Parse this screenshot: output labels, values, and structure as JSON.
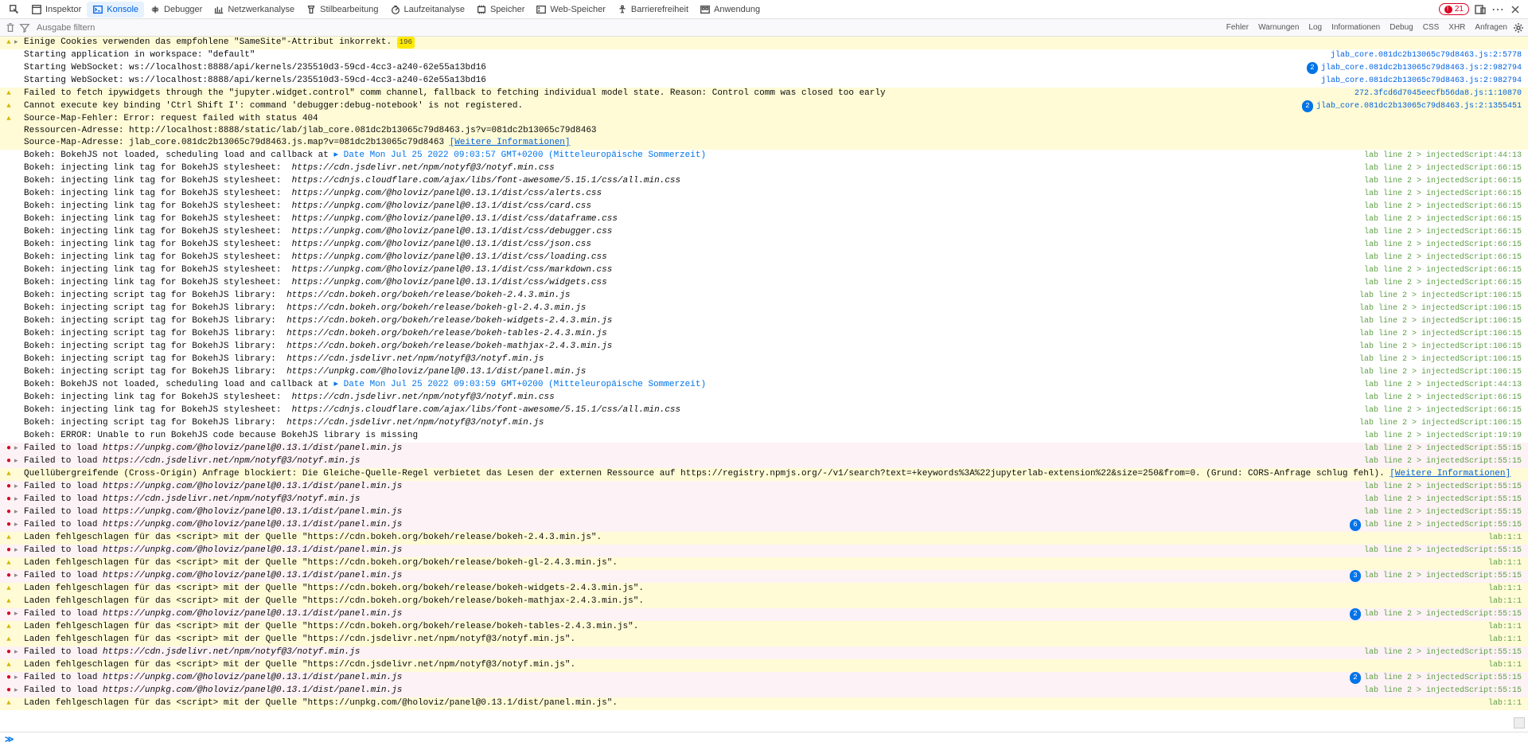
{
  "toolbar": {
    "tabs": [
      {
        "id": "pick",
        "label": "",
        "icon": "pick"
      },
      {
        "id": "inspector",
        "label": "Inspektor",
        "icon": "inspector"
      },
      {
        "id": "konsole",
        "label": "Konsole",
        "icon": "console",
        "active": true
      },
      {
        "id": "debugger",
        "label": "Debugger",
        "icon": "debugger"
      },
      {
        "id": "netz",
        "label": "Netzwerkanalyse",
        "icon": "network"
      },
      {
        "id": "stil",
        "label": "Stilbearbeitung",
        "icon": "style"
      },
      {
        "id": "lauf",
        "label": "Laufzeitanalyse",
        "icon": "perf"
      },
      {
        "id": "speicher",
        "label": "Speicher",
        "icon": "memory"
      },
      {
        "id": "web",
        "label": "Web-Speicher",
        "icon": "storage"
      },
      {
        "id": "barrier",
        "label": "Barrierefreiheit",
        "icon": "a11y"
      },
      {
        "id": "anwend",
        "label": "Anwendung",
        "icon": "app"
      }
    ],
    "error_count": "21"
  },
  "filterbar": {
    "placeholder": "Ausgabe filtern",
    "buttons": [
      "Fehler",
      "Warnungen",
      "Log",
      "Informationen",
      "Debug",
      "CSS",
      "XHR",
      "Anfragen"
    ]
  },
  "messages": [
    {
      "t": "warn",
      "exp": true,
      "badge": "196",
      "text": "Einige Cookies verwenden das empfohlene \"SameSite\"-Attribut inkorrekt.",
      "loc": ""
    },
    {
      "t": "info",
      "text": "Starting application in workspace: \"default\"",
      "loc": "jlab_core.081dc2b13065c79d8463.js:2:5778",
      "locfile": true
    },
    {
      "t": "info",
      "badge": "2",
      "text": "Starting WebSocket: ws://localhost:8888/api/kernels/235510d3-59cd-4cc3-a240-62e55a13bd16",
      "loc": "jlab_core.081dc2b13065c79d8463.js:2:982794",
      "locfile": true
    },
    {
      "t": "info",
      "text": "Starting WebSocket: ws://localhost:8888/api/kernels/235510d3-59cd-4cc3-a240-62e55a13bd16",
      "loc": "jlab_core.081dc2b13065c79d8463.js:2:982794",
      "locfile": true
    },
    {
      "t": "warn",
      "text": "Failed to fetch ipywidgets through the \"jupyter.widget.control\" comm channel, fallback to fetching individual model state. Reason: Control comm was closed too early",
      "loc": "272.3fcd6d7045eecfb56da8.js:1:10870",
      "locfile": true
    },
    {
      "t": "warn",
      "badge": "2",
      "text": "Cannot execute key binding 'Ctrl Shift I': command 'debugger:debug-notebook' is not registered.",
      "loc": "jlab_core.081dc2b13065c79d8463.js:2:1355451",
      "locfile": true
    },
    {
      "t": "warn",
      "multiline": true,
      "text": "Source-Map-Fehler: Error: request failed with status 404\nRessourcen-Adresse: http://localhost:8888/static/lab/jlab_core.081dc2b13065c79d8463.js?v=081dc2b13065c79d8463\nSource-Map-Adresse: jlab_core.081dc2b13065c79d8463.js.map?v=081dc2b13065c79d8463 ",
      "link": "[Weitere Informationen]",
      "loc": ""
    },
    {
      "t": "info",
      "text": "Bokeh: BokehJS not loaded, scheduling load and callback at ",
      "date": "▸ Date Mon Jul 25 2022 09:03:57 GMT+0200 (Mitteleuropäische Sommerzeit)",
      "loc": "lab line 2 > injectedScript:44:13"
    },
    {
      "t": "info",
      "text": "Bokeh: injecting link tag for BokehJS stylesheet:  ",
      "url": "https://cdn.jsdelivr.net/npm/notyf@3/notyf.min.css",
      "loc": "lab line 2 > injectedScript:66:15"
    },
    {
      "t": "info",
      "text": "Bokeh: injecting link tag for BokehJS stylesheet:  ",
      "url": "https://cdnjs.cloudflare.com/ajax/libs/font-awesome/5.15.1/css/all.min.css",
      "loc": "lab line 2 > injectedScript:66:15"
    },
    {
      "t": "info",
      "text": "Bokeh: injecting link tag for BokehJS stylesheet:  ",
      "url": "https://unpkg.com/@holoviz/panel@0.13.1/dist/css/alerts.css",
      "loc": "lab line 2 > injectedScript:66:15"
    },
    {
      "t": "info",
      "text": "Bokeh: injecting link tag for BokehJS stylesheet:  ",
      "url": "https://unpkg.com/@holoviz/panel@0.13.1/dist/css/card.css",
      "loc": "lab line 2 > injectedScript:66:15"
    },
    {
      "t": "info",
      "text": "Bokeh: injecting link tag for BokehJS stylesheet:  ",
      "url": "https://unpkg.com/@holoviz/panel@0.13.1/dist/css/dataframe.css",
      "loc": "lab line 2 > injectedScript:66:15"
    },
    {
      "t": "info",
      "text": "Bokeh: injecting link tag for BokehJS stylesheet:  ",
      "url": "https://unpkg.com/@holoviz/panel@0.13.1/dist/css/debugger.css",
      "loc": "lab line 2 > injectedScript:66:15"
    },
    {
      "t": "info",
      "text": "Bokeh: injecting link tag for BokehJS stylesheet:  ",
      "url": "https://unpkg.com/@holoviz/panel@0.13.1/dist/css/json.css",
      "loc": "lab line 2 > injectedScript:66:15"
    },
    {
      "t": "info",
      "text": "Bokeh: injecting link tag for BokehJS stylesheet:  ",
      "url": "https://unpkg.com/@holoviz/panel@0.13.1/dist/css/loading.css",
      "loc": "lab line 2 > injectedScript:66:15"
    },
    {
      "t": "info",
      "text": "Bokeh: injecting link tag for BokehJS stylesheet:  ",
      "url": "https://unpkg.com/@holoviz/panel@0.13.1/dist/css/markdown.css",
      "loc": "lab line 2 > injectedScript:66:15"
    },
    {
      "t": "info",
      "text": "Bokeh: injecting link tag for BokehJS stylesheet:  ",
      "url": "https://unpkg.com/@holoviz/panel@0.13.1/dist/css/widgets.css",
      "loc": "lab line 2 > injectedScript:66:15"
    },
    {
      "t": "info",
      "text": "Bokeh: injecting script tag for BokehJS library:  ",
      "url": "https://cdn.bokeh.org/bokeh/release/bokeh-2.4.3.min.js",
      "loc": "lab line 2 > injectedScript:106:15"
    },
    {
      "t": "info",
      "text": "Bokeh: injecting script tag for BokehJS library:  ",
      "url": "https://cdn.bokeh.org/bokeh/release/bokeh-gl-2.4.3.min.js",
      "loc": "lab line 2 > injectedScript:106:15"
    },
    {
      "t": "info",
      "text": "Bokeh: injecting script tag for BokehJS library:  ",
      "url": "https://cdn.bokeh.org/bokeh/release/bokeh-widgets-2.4.3.min.js",
      "loc": "lab line 2 > injectedScript:106:15"
    },
    {
      "t": "info",
      "text": "Bokeh: injecting script tag for BokehJS library:  ",
      "url": "https://cdn.bokeh.org/bokeh/release/bokeh-tables-2.4.3.min.js",
      "loc": "lab line 2 > injectedScript:106:15"
    },
    {
      "t": "info",
      "text": "Bokeh: injecting script tag for BokehJS library:  ",
      "url": "https://cdn.bokeh.org/bokeh/release/bokeh-mathjax-2.4.3.min.js",
      "loc": "lab line 2 > injectedScript:106:15"
    },
    {
      "t": "info",
      "text": "Bokeh: injecting script tag for BokehJS library:  ",
      "url": "https://cdn.jsdelivr.net/npm/notyf@3/notyf.min.js",
      "loc": "lab line 2 > injectedScript:106:15"
    },
    {
      "t": "info",
      "text": "Bokeh: injecting script tag for BokehJS library:  ",
      "url": "https://unpkg.com/@holoviz/panel@0.13.1/dist/panel.min.js",
      "loc": "lab line 2 > injectedScript:106:15"
    },
    {
      "t": "info",
      "text": "Bokeh: BokehJS not loaded, scheduling load and callback at ",
      "date": "▸ Date Mon Jul 25 2022 09:03:59 GMT+0200 (Mitteleuropäische Sommerzeit)",
      "loc": "lab line 2 > injectedScript:44:13"
    },
    {
      "t": "info",
      "text": "Bokeh: injecting link tag for BokehJS stylesheet:  ",
      "url": "https://cdn.jsdelivr.net/npm/notyf@3/notyf.min.css",
      "loc": "lab line 2 > injectedScript:66:15"
    },
    {
      "t": "info",
      "text": "Bokeh: injecting link tag for BokehJS stylesheet:  ",
      "url": "https://cdnjs.cloudflare.com/ajax/libs/font-awesome/5.15.1/css/all.min.css",
      "loc": "lab line 2 > injectedScript:66:15"
    },
    {
      "t": "info",
      "text": "Bokeh: injecting script tag for BokehJS library:  ",
      "url": "https://cdn.jsdelivr.net/npm/notyf@3/notyf.min.js",
      "loc": "lab line 2 > injectedScript:106:15"
    },
    {
      "t": "info",
      "text": "Bokeh: ERROR: Unable to run BokehJS code because BokehJS library is missing",
      "loc": "lab line 2 > injectedScript:19:19"
    },
    {
      "t": "err",
      "exp": true,
      "text": "Failed to load ",
      "url": "https://unpkg.com/@holoviz/panel@0.13.1/dist/panel.min.js",
      "loc": "lab line 2 > injectedScript:55:15"
    },
    {
      "t": "err",
      "exp": true,
      "text": "Failed to load ",
      "url": "https://cdn.jsdelivr.net/npm/notyf@3/notyf.min.js",
      "loc": "lab line 2 > injectedScript:55:15"
    },
    {
      "t": "warn",
      "text": "Quellübergreifende (Cross-Origin) Anfrage blockiert: Die Gleiche-Quelle-Regel verbietet das Lesen der externen Ressource auf https://registry.npmjs.org/-/v1/search?text=+keywords%3A%22jupyterlab-extension%22&size=250&from=0. (Grund: CORS-Anfrage schlug fehl). ",
      "link": "[Weitere Informationen]",
      "loc": ""
    },
    {
      "t": "err",
      "exp": true,
      "text": "Failed to load ",
      "url": "https://unpkg.com/@holoviz/panel@0.13.1/dist/panel.min.js",
      "loc": "lab line 2 > injectedScript:55:15"
    },
    {
      "t": "err",
      "exp": true,
      "text": "Failed to load ",
      "url": "https://cdn.jsdelivr.net/npm/notyf@3/notyf.min.js",
      "loc": "lab line 2 > injectedScript:55:15"
    },
    {
      "t": "err",
      "exp": true,
      "text": "Failed to load ",
      "url": "https://unpkg.com/@holoviz/panel@0.13.1/dist/panel.min.js",
      "loc": "lab line 2 > injectedScript:55:15"
    },
    {
      "t": "err",
      "exp": true,
      "badge": "6",
      "text": "Failed to load ",
      "url": "https://unpkg.com/@holoviz/panel@0.13.1/dist/panel.min.js",
      "loc": "lab line 2 > injectedScript:55:15"
    },
    {
      "t": "warn",
      "text": "Laden fehlgeschlagen für das <script> mit der Quelle \"https://cdn.bokeh.org/bokeh/release/bokeh-2.4.3.min.js\".",
      "loc": "lab:1:1"
    },
    {
      "t": "err",
      "exp": true,
      "text": "Failed to load ",
      "url": "https://unpkg.com/@holoviz/panel@0.13.1/dist/panel.min.js",
      "loc": "lab line 2 > injectedScript:55:15"
    },
    {
      "t": "warn",
      "text": "Laden fehlgeschlagen für das <script> mit der Quelle \"https://cdn.bokeh.org/bokeh/release/bokeh-gl-2.4.3.min.js\".",
      "loc": "lab:1:1"
    },
    {
      "t": "err",
      "exp": true,
      "badge": "3",
      "text": "Failed to load ",
      "url": "https://unpkg.com/@holoviz/panel@0.13.1/dist/panel.min.js",
      "loc": "lab line 2 > injectedScript:55:15"
    },
    {
      "t": "warn",
      "text": "Laden fehlgeschlagen für das <script> mit der Quelle \"https://cdn.bokeh.org/bokeh/release/bokeh-widgets-2.4.3.min.js\".",
      "loc": "lab:1:1"
    },
    {
      "t": "warn",
      "text": "Laden fehlgeschlagen für das <script> mit der Quelle \"https://cdn.bokeh.org/bokeh/release/bokeh-mathjax-2.4.3.min.js\".",
      "loc": "lab:1:1"
    },
    {
      "t": "err",
      "exp": true,
      "badge": "2",
      "text": "Failed to load ",
      "url": "https://unpkg.com/@holoviz/panel@0.13.1/dist/panel.min.js",
      "loc": "lab line 2 > injectedScript:55:15"
    },
    {
      "t": "warn",
      "text": "Laden fehlgeschlagen für das <script> mit der Quelle \"https://cdn.bokeh.org/bokeh/release/bokeh-tables-2.4.3.min.js\".",
      "loc": "lab:1:1"
    },
    {
      "t": "warn",
      "text": "Laden fehlgeschlagen für das <script> mit der Quelle \"https://cdn.jsdelivr.net/npm/notyf@3/notyf.min.js\".",
      "loc": "lab:1:1"
    },
    {
      "t": "err",
      "exp": true,
      "text": "Failed to load ",
      "url": "https://cdn.jsdelivr.net/npm/notyf@3/notyf.min.js",
      "loc": "lab line 2 > injectedScript:55:15"
    },
    {
      "t": "warn",
      "text": "Laden fehlgeschlagen für das <script> mit der Quelle \"https://cdn.jsdelivr.net/npm/notyf@3/notyf.min.js\".",
      "loc": "lab:1:1"
    },
    {
      "t": "err",
      "exp": true,
      "badge": "2",
      "text": "Failed to load ",
      "url": "https://unpkg.com/@holoviz/panel@0.13.1/dist/panel.min.js",
      "loc": "lab line 2 > injectedScript:55:15"
    },
    {
      "t": "err",
      "exp": true,
      "text": "Failed to load ",
      "url": "https://unpkg.com/@holoviz/panel@0.13.1/dist/panel.min.js",
      "loc": "lab line 2 > injectedScript:55:15"
    },
    {
      "t": "warn",
      "text": "Laden fehlgeschlagen für das <script> mit der Quelle \"https://unpkg.com/@holoviz/panel@0.13.1/dist/panel.min.js\".",
      "loc": "lab:1:1"
    }
  ]
}
